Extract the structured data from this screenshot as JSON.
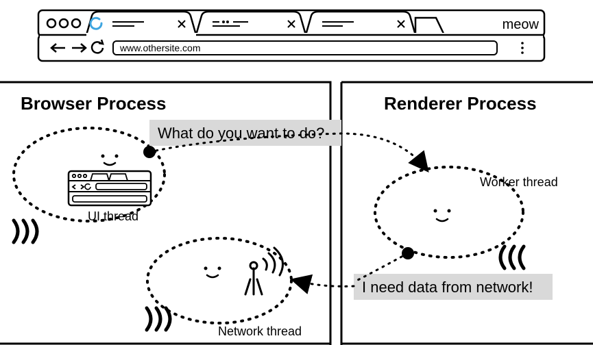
{
  "browser": {
    "url": "www.othersite.com",
    "brand": "meow"
  },
  "processes": {
    "left_title": "Browser Process",
    "right_title": "Renderer Process"
  },
  "threads": {
    "ui": "UI thread",
    "network": "Network thread",
    "worker": "Worker thread"
  },
  "speech": {
    "question": "What do you want to do?",
    "answer": "I need data from network!"
  }
}
